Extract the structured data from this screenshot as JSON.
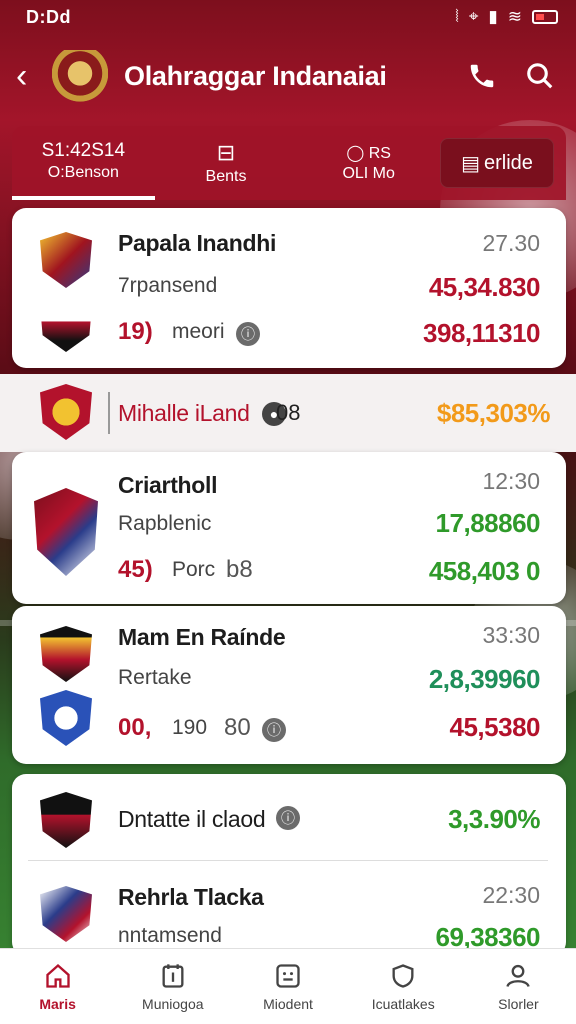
{
  "status": {
    "time": "D:Dd"
  },
  "header": {
    "title": "Olahraggar Indanaiai"
  },
  "tabs": [
    {
      "line1": "S1:42S14",
      "line2": "O:Benson"
    },
    {
      "line1": "",
      "line2": "Bents"
    },
    {
      "line1": "RS",
      "line2": "OLI Mo"
    }
  ],
  "tab_button": {
    "label": "erlide"
  },
  "matches": [
    {
      "title": "Papala Inandhi",
      "time": "27.30",
      "sub": "7rpansend",
      "value1": "45,34.830",
      "score": "19)",
      "score_label": "meori",
      "value2": "398,11310"
    },
    {
      "strip_title": "Mihalle iLand",
      "strip_num": "08",
      "strip_value": "$85,303%"
    },
    {
      "title": "Criartholl",
      "time": "12:30",
      "sub": "Rapblenic",
      "value1": "17,88860",
      "score": "45)",
      "score_label": "Porc",
      "score_extra": "b8",
      "value2": "458,403 0"
    },
    {
      "title": "Mam En Raínde",
      "time": "33:30",
      "sub": "Rertake",
      "value1": "2,8,39960",
      "score": "00,",
      "score_label": "190",
      "score_extra": "80",
      "value2": "45,5380"
    },
    {
      "title": "Dntatte il claod",
      "value1": "3,3.90%"
    },
    {
      "title": "Rehrla Tlacka",
      "time": "22:30",
      "sub": "nntamsend",
      "value1": "69,38360"
    }
  ],
  "bottom_nav": [
    {
      "label": "Maris"
    },
    {
      "label": "Muniogoa"
    },
    {
      "label": "Miodent"
    },
    {
      "label": "Icuatlakes"
    },
    {
      "label": "Slorler"
    }
  ],
  "colors": {
    "primary": "#b3122c",
    "green": "#2f9a2a",
    "orange": "#f29a1a"
  },
  "icons": [
    "back-arrow-icon",
    "phone-icon",
    "search-icon",
    "home-icon",
    "calendar-icon",
    "message-icon",
    "shield-icon",
    "person-icon"
  ]
}
